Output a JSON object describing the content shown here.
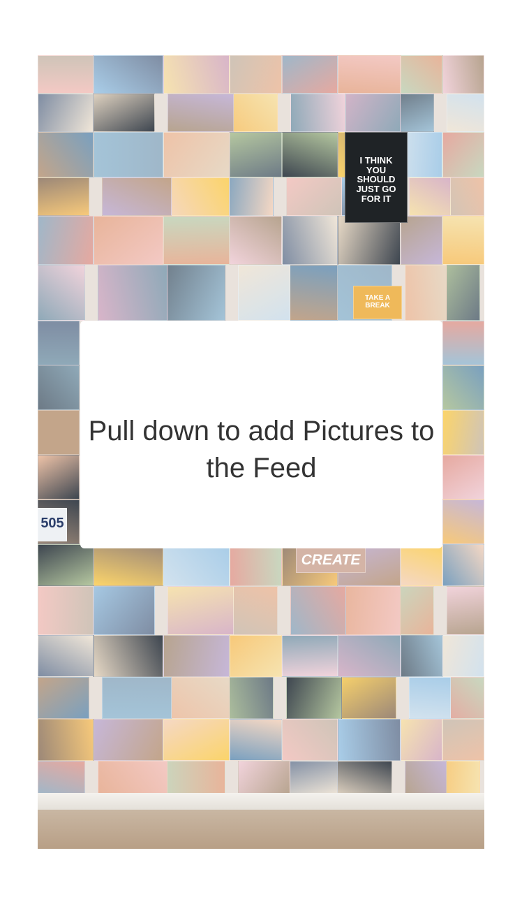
{
  "feed": {
    "empty_state_message": "Pull down to add Pictures to the Feed"
  },
  "background_image": {
    "visible_texts": {
      "should_poster": "I THINK YOU SHOULD JUST GO FOR IT",
      "create_poster": "CREATE",
      "break_poster": "TAKE A BREAK",
      "plate_number": "505"
    }
  },
  "colors": {
    "screen_background": "#ffffff",
    "card_background": "#ffffff",
    "message_text": "#333333"
  }
}
